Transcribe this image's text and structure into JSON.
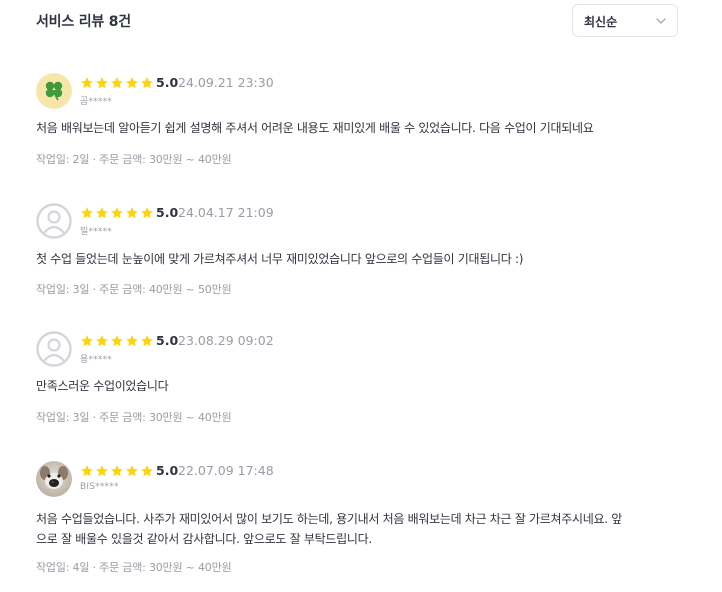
{
  "header": {
    "title": "서비스 리뷰 8건",
    "sort_selected": "최신순"
  },
  "colors": {
    "star": "#FFD400",
    "text": "#303441",
    "muted": "#9A9BA7",
    "border": "#E4E5ED"
  },
  "reviews": [
    {
      "avatar": "clover-avatar",
      "score": "5.0",
      "date": "24.09.21 23:30",
      "nickname": "곰*****",
      "text": "처음 배워보는데 알아듣기 쉽게 설명해 주셔서 어려운 내용도 재미있게 배울 수 있었습니다. 다음 수업이 기대되네요",
      "meta": "작업일: 2일 · 주문 금액: 30만원 ~ 40만원"
    },
    {
      "avatar": "default-avatar",
      "score": "5.0",
      "date": "24.04.17 21:09",
      "nickname": "밀*****",
      "text": "첫 수업 들었는데 눈높이에 맞게 가르쳐주셔서 너무 재미있었습니다 앞으로의 수업들이 기대됩니다 :)",
      "meta": "작업일: 3일 · 주문 금액: 40만원 ~ 50만원"
    },
    {
      "avatar": "default-avatar",
      "score": "5.0",
      "date": "23.08.29 09:02",
      "nickname": "용*****",
      "text": "만족스러운 수업이었습니다",
      "meta": "작업일: 3일 · 주문 금액: 30만원 ~ 40만원"
    },
    {
      "avatar": "dog-avatar",
      "score": "5.0",
      "date": "22.07.09 17:48",
      "nickname": "BIS*****",
      "text": "처음 수업들었습니다. 사주가 재미있어서 많이 보기도 하는데, 용기내서 처음 배워보는데 차근 차근 잘 가르쳐주시네요. 앞으로 잘 배울수 있을것 같아서 감사합니다. 앞으로도 잘 부탁드립니다.",
      "meta": "작업일: 4일 · 주문 금액: 30만원 ~ 40만원"
    }
  ]
}
